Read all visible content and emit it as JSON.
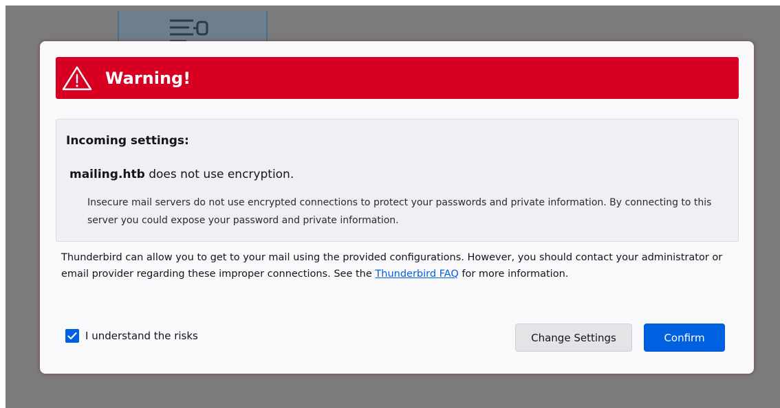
{
  "dialog": {
    "warning": {
      "icon": "warning-triangle-icon",
      "title": "Warning!"
    },
    "incoming": {
      "heading": "Incoming settings:",
      "host": "mailing.htb",
      "encryption_note": " does not use encryption.",
      "description": "Insecure mail servers do not use encrypted connections to protect your passwords and private information. By connecting to this server you could expose your password and private information."
    },
    "info": {
      "text_before_link": "Thunderbird can allow you to get to your mail using the provided configurations. However, you should contact your administrator or email provider regarding these improper connections. See the ",
      "link_text": "Thunderbird FAQ",
      "text_after_link": " for more information."
    },
    "risk_checkbox": {
      "label": "I understand the risks",
      "checked": true
    },
    "buttons": {
      "change_settings": "Change Settings",
      "confirm": "Confirm"
    }
  },
  "colors": {
    "warning_red": "#d70022",
    "accent_blue": "#0061e0",
    "backdrop": "#7b7b7b"
  }
}
